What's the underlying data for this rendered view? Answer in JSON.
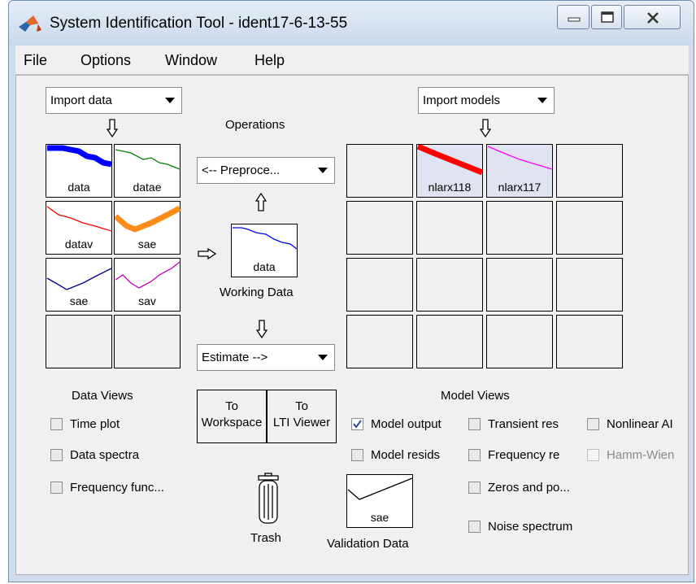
{
  "window": {
    "title": "System Identification Tool - ident17-6-13-55"
  },
  "menu": [
    "File",
    "Options",
    "Window",
    "Help"
  ],
  "data_panel": {
    "import_label": "Import data",
    "icons": [
      "data",
      "datae",
      "datav",
      "sae",
      "sae",
      "sav",
      "",
      ""
    ],
    "views_label": "Data Views",
    "checkboxes": [
      {
        "label": "Time plot",
        "checked": false
      },
      {
        "label": "Data spectra",
        "checked": false
      },
      {
        "label": "Frequency func...",
        "checked": false
      }
    ]
  },
  "operations": {
    "title": "Operations",
    "preprocess_label": "<-- Preproce...",
    "working_data_label": "Working Data",
    "working_data_name": "data",
    "estimate_label": "Estimate -->",
    "to_workspace": [
      "To",
      "Workspace"
    ],
    "to_lti_viewer": [
      "To",
      "LTI Viewer"
    ],
    "trash_label": "Trash",
    "validation_label": "Validation Data",
    "validation_name": "sae"
  },
  "model_panel": {
    "import_label": "Import models",
    "icons": [
      "",
      "nlarx118",
      "nlarx117",
      "",
      "",
      "",
      "",
      "",
      "",
      "",
      "",
      "",
      "",
      "",
      "",
      ""
    ],
    "views_label": "Model Views",
    "checkboxes": [
      {
        "label": "Model output",
        "checked": true
      },
      {
        "label": "Transient res",
        "checked": false
      },
      {
        "label": "Nonlinear AI",
        "checked": false
      },
      {
        "label": "Model resids",
        "checked": false
      },
      {
        "label": "Frequency re",
        "checked": false
      },
      {
        "label": "Hamm-Wien",
        "checked": false,
        "disabled": true
      },
      {
        "label": "Zeros and po...",
        "checked": false
      },
      {
        "label": "Noise spectrum",
        "checked": false
      }
    ]
  },
  "colors": {
    "data": "#0000ff",
    "datae": "#008000",
    "datav": "#ff0000",
    "sae_thick": "#ff8c1a",
    "sae": "#00008b",
    "sav": "#bf00bf",
    "nlarx118": "#ff0000",
    "nlarx117": "#ff00ff"
  }
}
